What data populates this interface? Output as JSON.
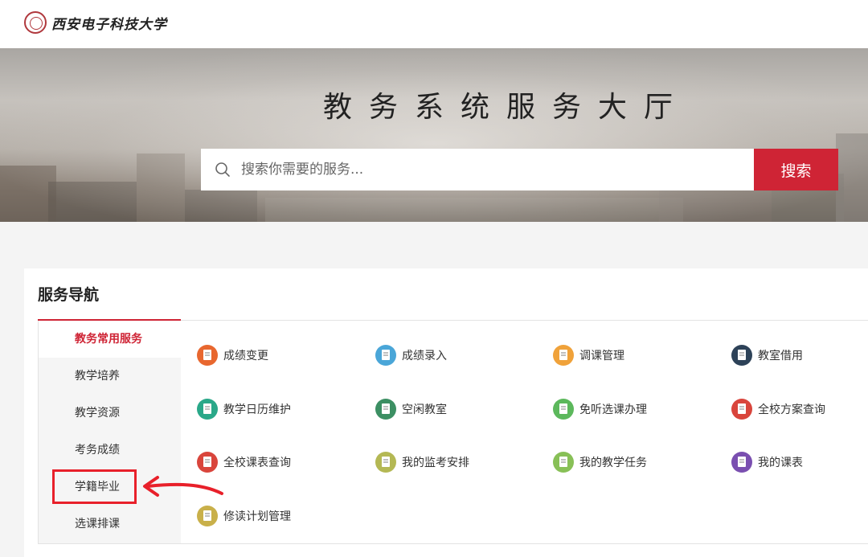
{
  "header": {
    "school_name": "西安电子科技大学"
  },
  "banner": {
    "title": "教务系统服务大厅",
    "search_placeholder": "搜索你需要的服务...",
    "search_button": "搜索"
  },
  "nav": {
    "title": "服务导航",
    "categories": [
      {
        "label": "教务常用服务",
        "active": true
      },
      {
        "label": "教学培养",
        "active": false
      },
      {
        "label": "教学资源",
        "active": false
      },
      {
        "label": "考务成绩",
        "active": false
      },
      {
        "label": "学籍毕业",
        "active": false
      },
      {
        "label": "选课排课",
        "active": false
      }
    ],
    "services": [
      {
        "label": "成绩变更",
        "icon": "grade-change-icon",
        "color": "#e8672f"
      },
      {
        "label": "成绩录入",
        "icon": "grade-entry-icon",
        "color": "#4aa6d8"
      },
      {
        "label": "调课管理",
        "icon": "class-schedule-adjust-icon",
        "color": "#f0a23a"
      },
      {
        "label": "教室借用",
        "icon": "classroom-borrow-icon",
        "color": "#2d4258"
      },
      {
        "label": "教学日历维护",
        "icon": "teaching-calendar-icon",
        "color": "#2aa889"
      },
      {
        "label": "空闲教室",
        "icon": "free-classroom-icon",
        "color": "#3c8f63"
      },
      {
        "label": "免听选课办理",
        "icon": "exempt-course-icon",
        "color": "#5cb85c"
      },
      {
        "label": "全校方案查询",
        "icon": "school-plan-query-icon",
        "color": "#d9453c"
      },
      {
        "label": "全校课表查询",
        "icon": "school-timetable-query-icon",
        "color": "#d9453c"
      },
      {
        "label": "我的监考安排",
        "icon": "my-invigilation-icon",
        "color": "#b4b854"
      },
      {
        "label": "我的教学任务",
        "icon": "my-teaching-task-icon",
        "color": "#88c057"
      },
      {
        "label": "我的课表",
        "icon": "my-timetable-icon",
        "color": "#7a4fb0"
      },
      {
        "label": "修读计划管理",
        "icon": "study-plan-icon",
        "color": "#c9b04a"
      }
    ]
  },
  "colors": {
    "accent": "#cf2435",
    "annotation": "#e8202a"
  }
}
